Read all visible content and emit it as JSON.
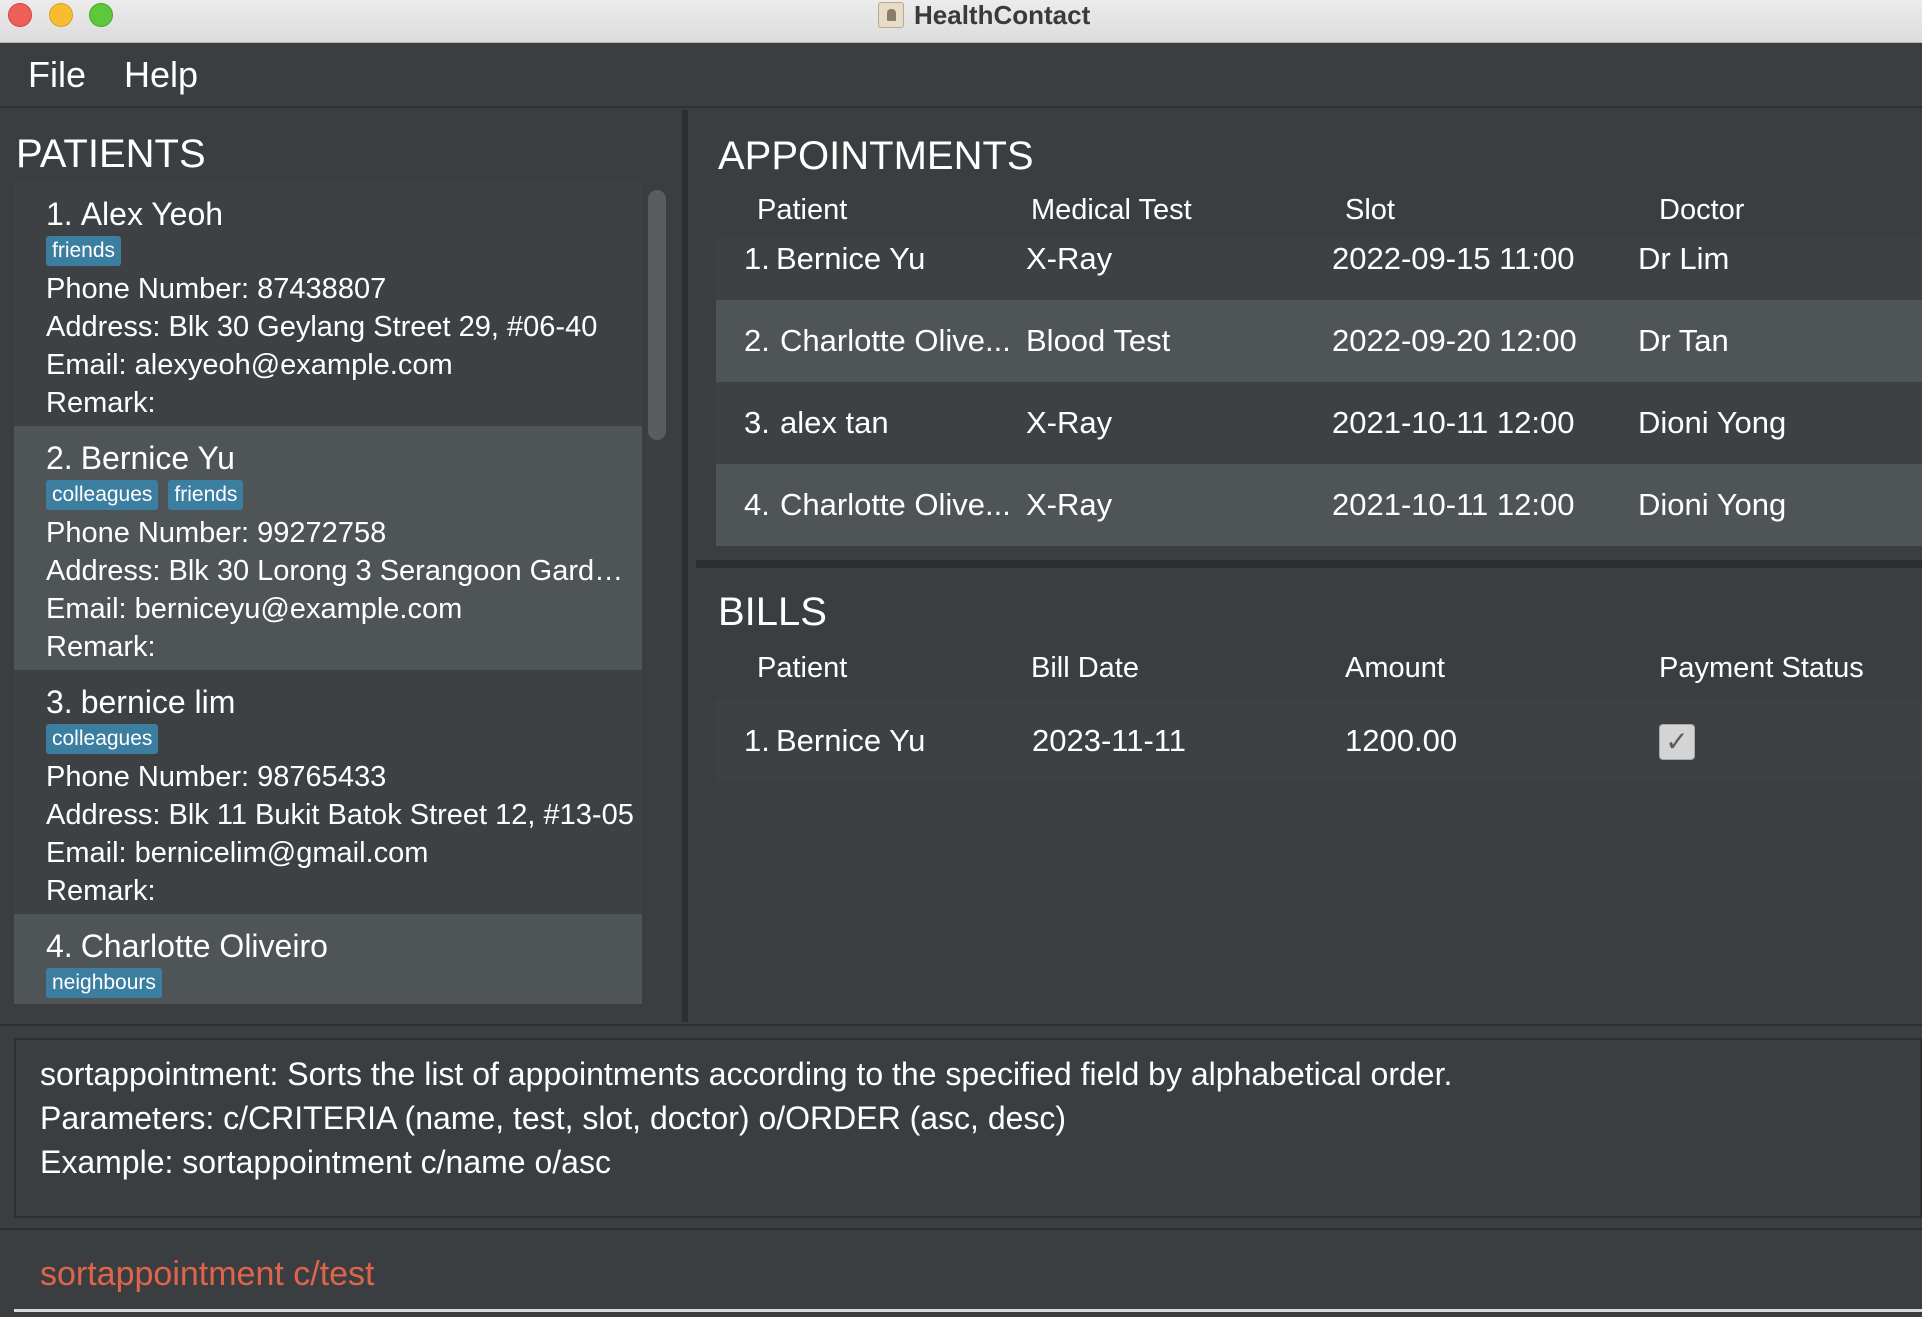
{
  "window": {
    "title": "HealthContact",
    "app_icon": "contact-book-icon"
  },
  "menu": {
    "items": [
      "File",
      "Help"
    ]
  },
  "patients": {
    "title": "PATIENTS",
    "list": [
      {
        "index": "1.",
        "name": "Alex Yeoh",
        "tags": [
          "friends"
        ],
        "phone": "Phone Number: 87438807",
        "address": "Address: Blk 30 Geylang Street 29, #06-40",
        "email": "Email: alexyeoh@example.com",
        "remark": "Remark:"
      },
      {
        "index": "2.",
        "name": "Bernice Yu",
        "tags": [
          "colleagues",
          "friends"
        ],
        "phone": "Phone Number: 99272758",
        "address": "Address: Blk 30 Lorong 3 Serangoon Garden...",
        "email": "Email: berniceyu@example.com",
        "remark": "Remark:"
      },
      {
        "index": "3.",
        "name": "bernice lim",
        "tags": [
          "colleagues"
        ],
        "phone": "Phone Number: 98765433",
        "address": "Address: Blk 11 Bukit Batok Street 12, #13-05",
        "email": "Email: bernicelim@gmail.com",
        "remark": "Remark:"
      },
      {
        "index": "4.",
        "name": "Charlotte Oliveiro",
        "tags": [
          "neighbours"
        ],
        "phone": "",
        "address": "",
        "email": "",
        "remark": ""
      }
    ]
  },
  "appointments": {
    "title": "APPOINTMENTS",
    "columns": [
      "Patient",
      "Medical Test",
      "Slot",
      "Doctor"
    ],
    "rows": [
      {
        "index": "1.",
        "patient": "Bernice Yu",
        "test": "X-Ray",
        "slot": "2022-09-15 11:00",
        "doctor": "Dr Lim"
      },
      {
        "index": "2.",
        "patient": "Charlotte Olive...",
        "test": "Blood Test",
        "slot": "2022-09-20 12:00",
        "doctor": "Dr Tan"
      },
      {
        "index": "3.",
        "patient": "alex tan",
        "test": "X-Ray",
        "slot": "2021-10-11 12:00",
        "doctor": "Dioni Yong"
      },
      {
        "index": "4.",
        "patient": "Charlotte Olive...",
        "test": "X-Ray",
        "slot": "2021-10-11 12:00",
        "doctor": "Dioni Yong"
      }
    ]
  },
  "bills": {
    "title": "BILLS",
    "columns": [
      "Patient",
      "Bill Date",
      "Amount",
      "Payment Status"
    ],
    "rows": [
      {
        "index": "1.",
        "patient": "Bernice Yu",
        "date": "2023-11-11",
        "amount": "1200.00",
        "paid": true
      }
    ]
  },
  "result": {
    "lines": [
      "sortappointment: Sorts the list of appointments according to the specified field by alphabetical order.",
      "Parameters: c/CRITERIA (name, test, slot, doctor) o/ORDER (asc, desc)",
      "Example: sortappointment c/name o/asc"
    ]
  },
  "command": {
    "value": "sortappointment c/test"
  },
  "colors": {
    "command_text": "#e0644b",
    "tag_bg": "#3b7ea0",
    "row_alt": "#4f5457",
    "background": "#3b3e40"
  }
}
